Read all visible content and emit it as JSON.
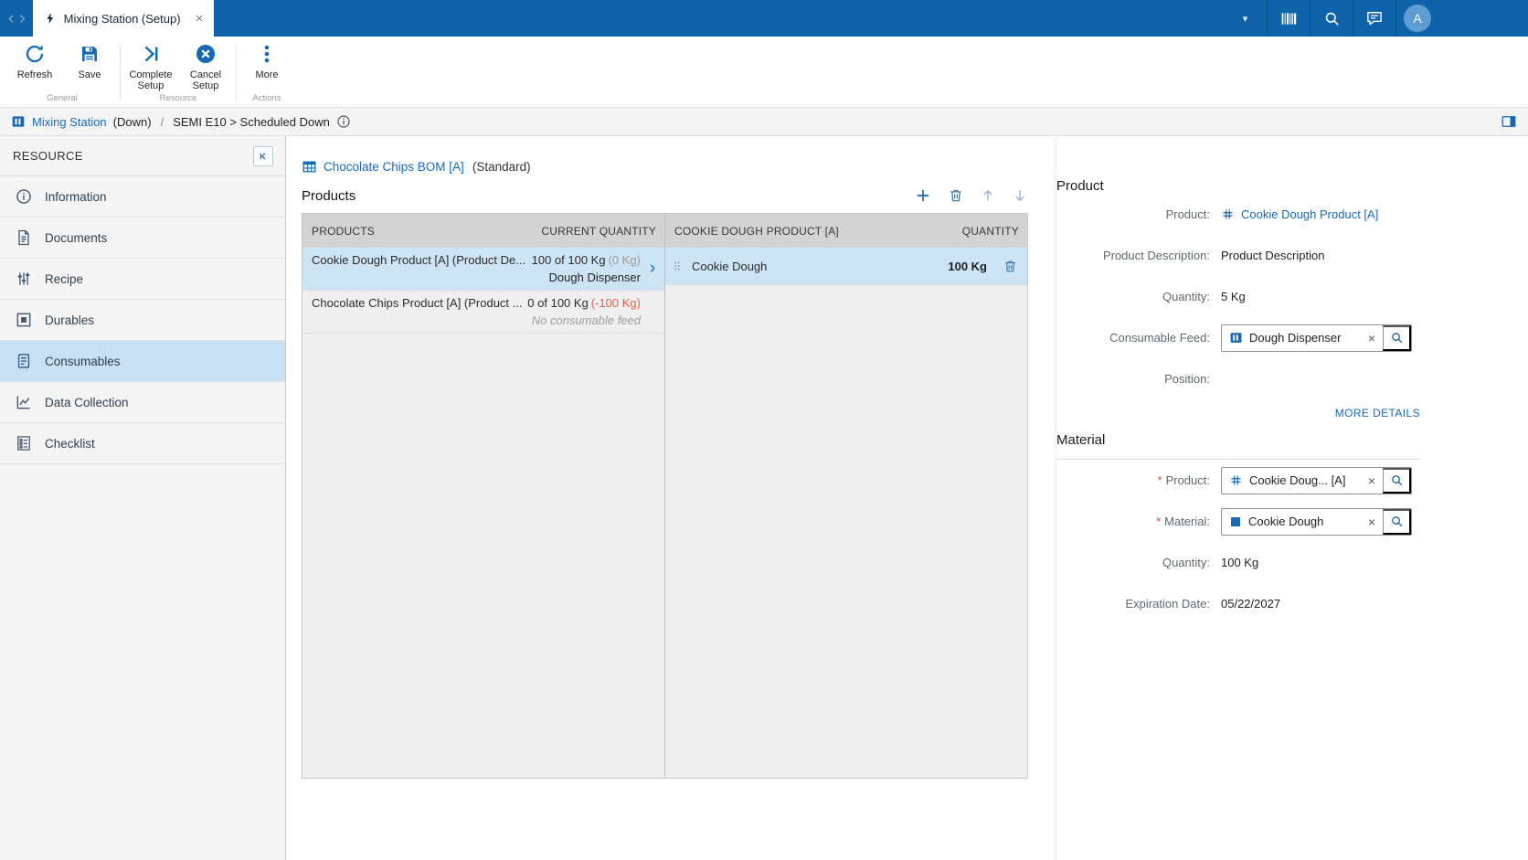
{
  "app": {
    "topbar": {
      "tab_title": "Mixing Station (Setup)",
      "avatar_initial": "A"
    },
    "ribbon": {
      "refresh_label": "Refresh",
      "save_label": "Save",
      "complete_setup_label": "Complete Setup",
      "cancel_setup_label": "Cancel Setup",
      "more_label": "More",
      "group_general": "General",
      "group_resource": "Resource",
      "group_actions": "Actions"
    },
    "breadcrumb": {
      "resource_name": "Mixing Station",
      "resource_state": "(Down)",
      "separator": "/",
      "state_reason": "SEMI E10 > Scheduled Down"
    }
  },
  "sidebar": {
    "title": "RESOURCE",
    "items": [
      {
        "label": "Information",
        "selected": false
      },
      {
        "label": "Documents",
        "selected": false
      },
      {
        "label": "Recipe",
        "selected": false
      },
      {
        "label": "Durables",
        "selected": false
      },
      {
        "label": "Consumables",
        "selected": true
      },
      {
        "label": "Data Collection",
        "selected": false
      },
      {
        "label": "Checklist",
        "selected": false
      }
    ]
  },
  "main": {
    "bom_title": "Chocolate Chips BOM [A]",
    "bom_variant": "(Standard)",
    "section_title": "Products",
    "left_table": {
      "col_products": "PRODUCTS",
      "col_quantity": "CURRENT QUANTITY",
      "rows": [
        {
          "name": "Cookie Dough Product [A] (Product De...",
          "quantity": "100 of 100 Kg",
          "delta": "(0 Kg)",
          "feed": "Dough Dispenser",
          "selected": true
        },
        {
          "name": "Chocolate Chips Product [A] (Product ...",
          "quantity": "0 of 100 Kg",
          "delta": "(-100 Kg)",
          "feed": "No consumable feed",
          "selected": false
        }
      ]
    },
    "right_table": {
      "col_product": "COOKIE DOUGH PRODUCT [A]",
      "col_quantity": "QUANTITY",
      "rows": [
        {
          "name": "Cookie Dough",
          "quantity": "100 Kg",
          "selected": true
        }
      ]
    }
  },
  "details": {
    "product_section": {
      "title": "Product",
      "product_label": "Product:",
      "product_value": "Cookie Dough Product [A]",
      "description_label": "Product Description:",
      "description_value": "Product Description",
      "quantity_label": "Quantity:",
      "quantity_value": "5 Kg",
      "consumable_feed_label": "Consumable Feed:",
      "consumable_feed_value": "Dough Dispenser",
      "position_label": "Position:",
      "position_value": "",
      "more_details_label": "MORE DETAILS"
    },
    "material_section": {
      "title": "Material",
      "required_marker": "*",
      "product_label": "Product:",
      "product_value": "Cookie Doug... [A]",
      "material_label": "Material:",
      "material_value": "Cookie Dough",
      "quantity_label": "Quantity:",
      "quantity_value": "100 Kg",
      "expiration_label": "Expiration Date:",
      "expiration_value": "05/22/2027"
    }
  },
  "icons": {
    "nav_back": "‹",
    "nav_forward": "›",
    "tab_close": "×",
    "dropdown_chevron": "▾",
    "row_chevron": "›",
    "picker_clear": "×"
  },
  "colors": {
    "topbar": "#0e63a9",
    "accent": "#1769b3",
    "negative": "#e0604d",
    "selected_row": "#cde4f5"
  }
}
